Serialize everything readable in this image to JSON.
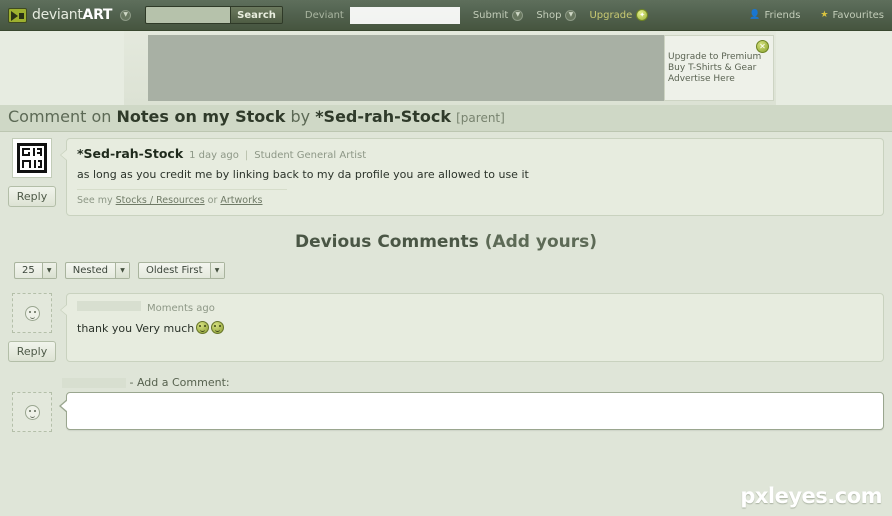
{
  "topbar": {
    "logo_text": "deviant",
    "logo_text_bold": "ART",
    "logo_icon": "deviantart-logo-icon",
    "nav_caret_icon": "chevron-down-circle-icon",
    "search": {
      "value": "",
      "placeholder": "",
      "button_label": "Search"
    },
    "deviant_label": "Deviant",
    "deviant_value": "",
    "items": [
      {
        "label": "Submit",
        "icon": "chevron-down-circle-icon"
      },
      {
        "label": "Shop",
        "icon": "chevron-down-circle-icon"
      },
      {
        "label": "Upgrade",
        "icon": "star-circle-icon"
      }
    ],
    "right_items": [
      {
        "label": "Friends",
        "icon": "friends-icon"
      },
      {
        "label": "Favourites",
        "icon": "star-icon"
      }
    ]
  },
  "ad": {
    "close_icon": "close-icon",
    "close_label": "✕",
    "links": [
      "Upgrade to Premium",
      "Buy T-Shirts & Gear",
      "Advertise Here"
    ]
  },
  "page_title": {
    "prefix": "Comment on ",
    "subject": "Notes on my Stock",
    "by": " by ",
    "author": "*Sed-rah-Stock",
    "parent": "[parent]"
  },
  "parent_comment": {
    "avatar_name": "sed-rah-stock-avatar",
    "username": "*Sed-rah-Stock",
    "timestamp": "1 day ago",
    "separator": "|",
    "user_title": "Student General Artist",
    "text": "as long as you credit me by linking back to my da profile you are allowed to use it",
    "signature_prefix": "See my ",
    "signature_link1": "Stocks / Resources",
    "signature_mid": " or ",
    "signature_link2": "Artworks",
    "reply_label": "Reply"
  },
  "devious": {
    "heading": "Devious Comments ",
    "add_yours": "(Add yours)"
  },
  "filters": [
    {
      "name": "per-page",
      "value": "25"
    },
    {
      "name": "threading",
      "value": "Nested"
    },
    {
      "name": "sort-order",
      "value": "Oldest First"
    }
  ],
  "reply_comment": {
    "avatar_name": "anonymous-avatar",
    "username": "",
    "timestamp": "Moments ago",
    "text": "thank you Very much",
    "emoticons": [
      "smiley-emoticon",
      "smiley-emoticon"
    ],
    "reply_label": "Reply"
  },
  "add_comment": {
    "username": "",
    "label": "- Add a Comment:",
    "avatar_name": "current-user-avatar",
    "textarea_value": "",
    "textarea_placeholder": ""
  },
  "watermark": "pxleyes.com",
  "colors": {
    "topbar": "#52624f",
    "page_bg": "#dfe5d8",
    "title_band": "#cfd8c6",
    "comment_bg": "#e7ecdf",
    "accent_green": "#9bb23a"
  }
}
